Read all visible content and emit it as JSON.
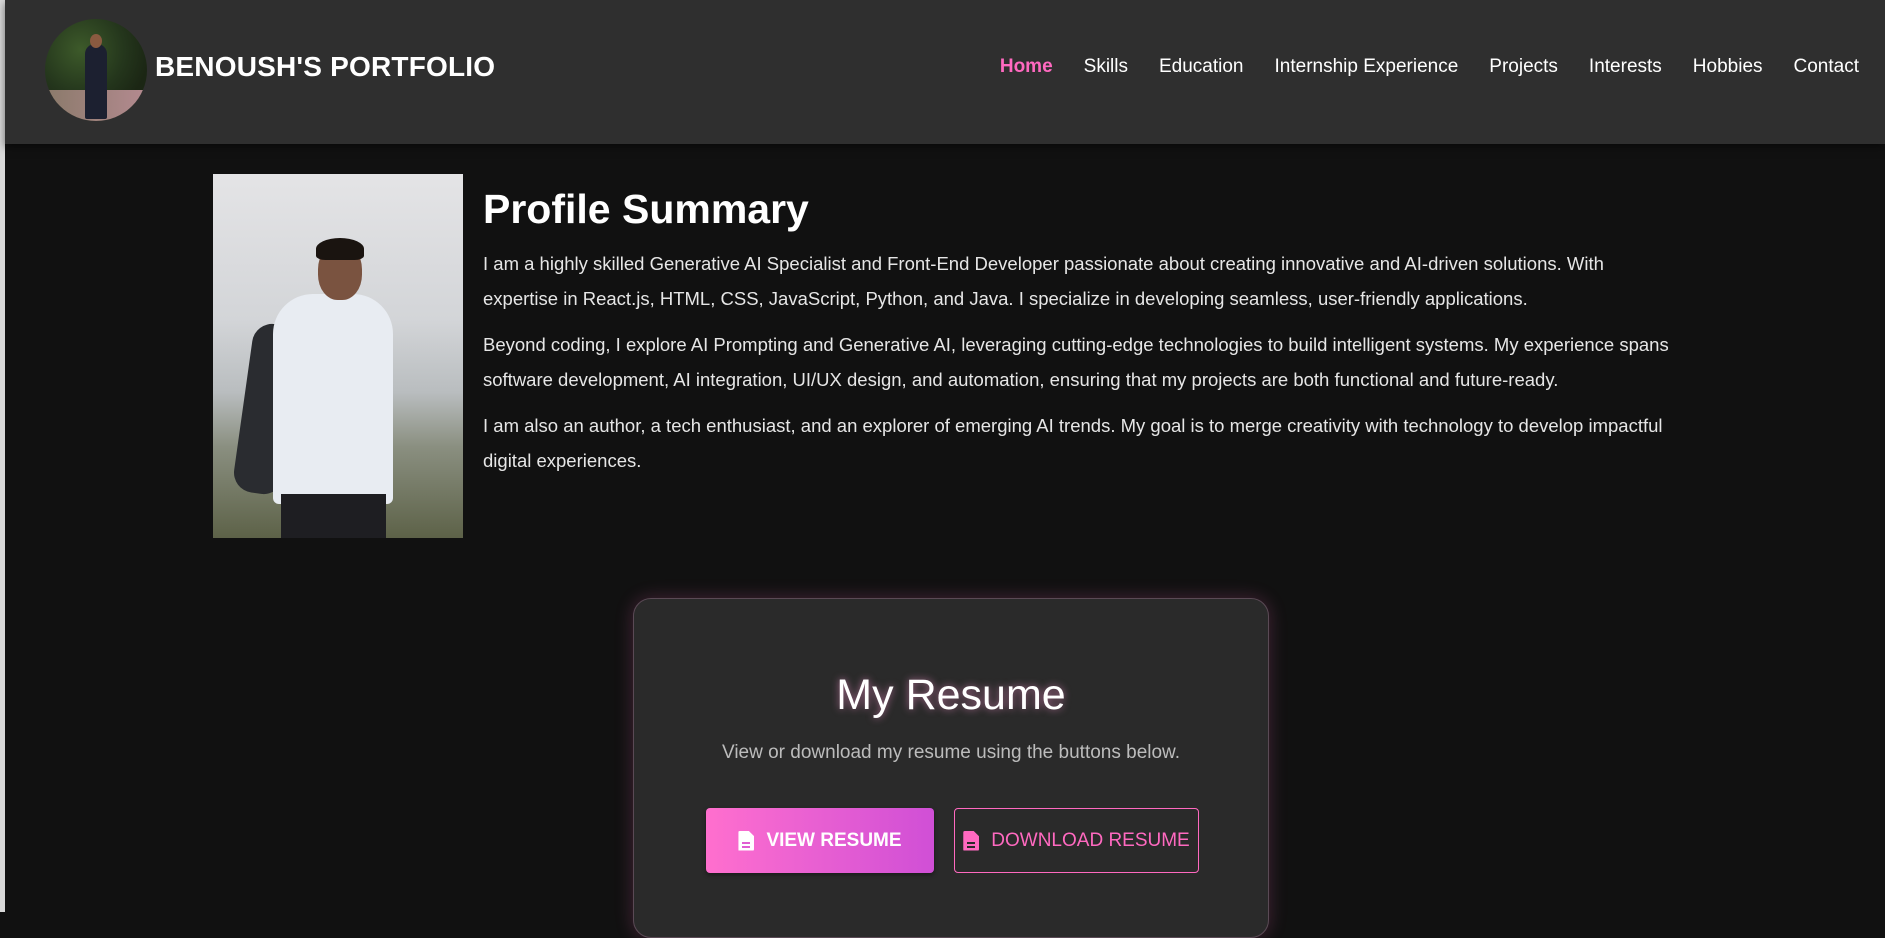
{
  "header": {
    "brand": "BENOUSH'S PORTFOLIO",
    "nav": [
      "Home",
      "Skills",
      "Education",
      "Internship Experience",
      "Projects",
      "Interests",
      "Hobbies",
      "Contact"
    ],
    "active": "Home"
  },
  "profile": {
    "title": "Profile Summary",
    "paragraphs": [
      "I am a highly skilled Generative AI Specialist and Front-End Developer passionate about creating innovative and AI-driven solutions. With expertise in React.js, HTML, CSS, JavaScript, Python, and Java. I specialize in developing seamless, user-friendly applications.",
      "Beyond coding, I explore AI Prompting and Generative AI, leveraging cutting-edge technologies to build intelligent systems. My experience spans software development, AI integration, UI/UX design, and automation, ensuring that my projects are both functional and future-ready.",
      "I am also an author, a tech enthusiast, and an explorer of emerging AI trends. My goal is to merge creativity with technology to develop impactful digital experiences."
    ]
  },
  "resume": {
    "title": "My Resume",
    "subtitle": "View or download my resume using the buttons below.",
    "view_label": "VIEW RESUME",
    "download_label": "DOWNLOAD RESUME",
    "icon": "document-icon"
  },
  "colors": {
    "accent": "#ff69c0",
    "background": "#111111",
    "header": "#2f2f2f",
    "card": "#2a2a2a"
  }
}
